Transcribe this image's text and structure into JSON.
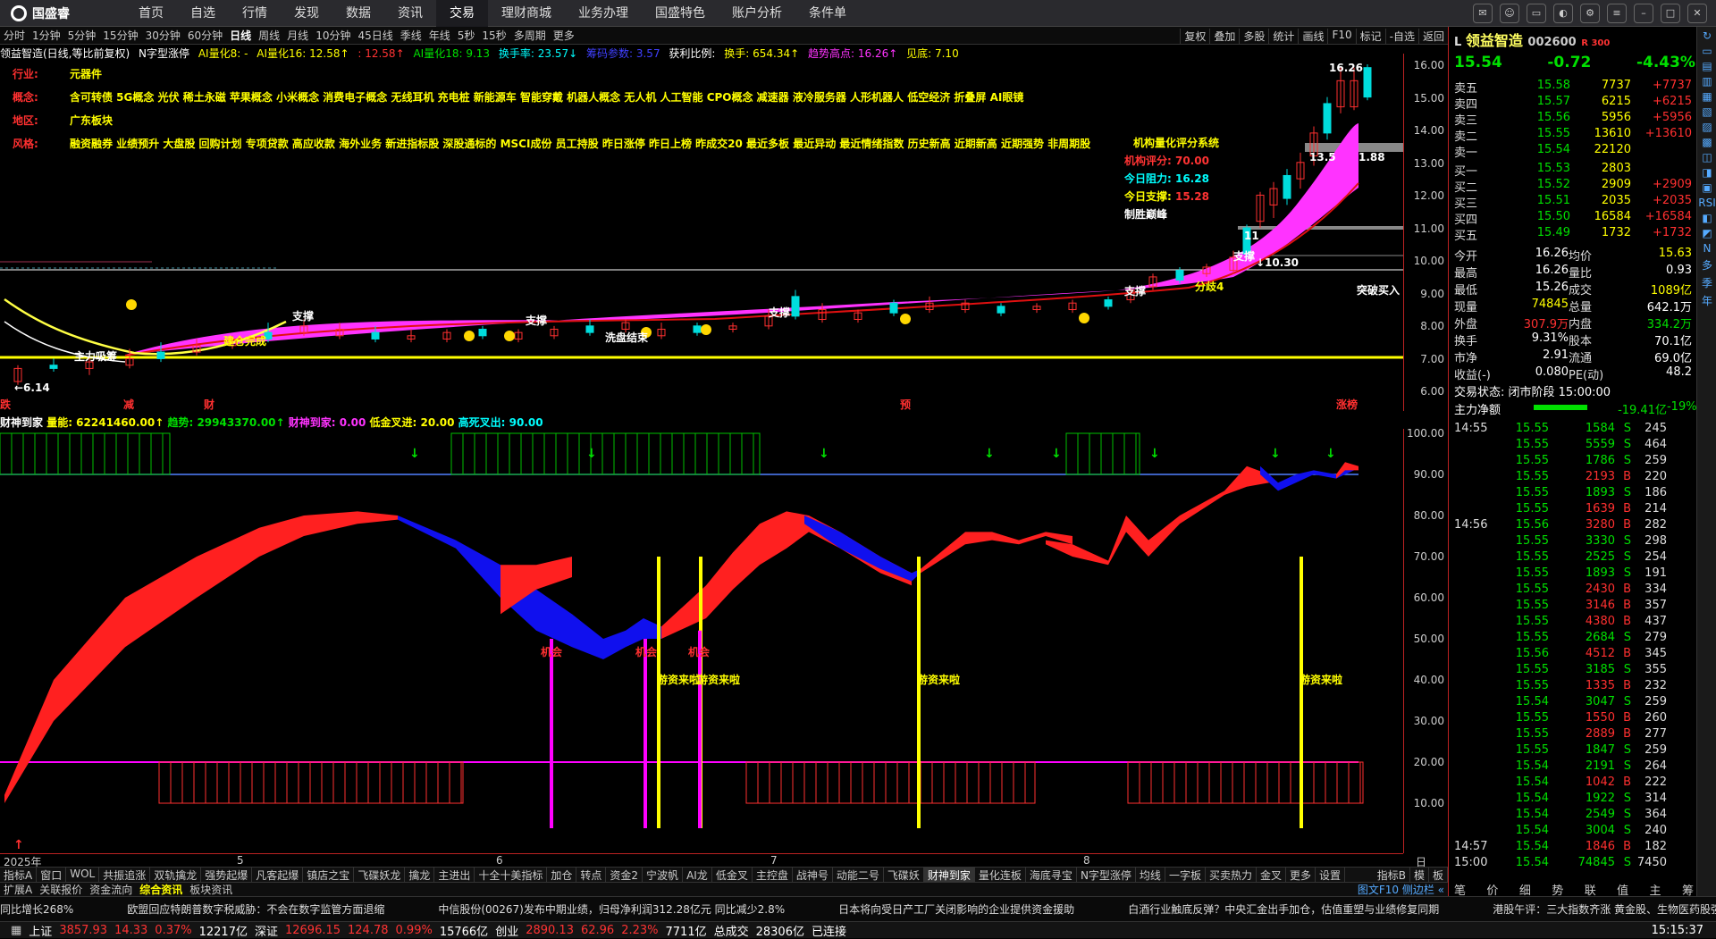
{
  "topbar": {
    "logo": "国盛睿",
    "menu": [
      "首页",
      "自选",
      "行情",
      "发现",
      "数据",
      "资讯",
      "交易",
      "理财商城",
      "业务办理",
      "国盛特色",
      "账户分析",
      "条件单"
    ],
    "selected": "交易"
  },
  "periods": [
    "分时",
    "1分钟",
    "5分钟",
    "15分钟",
    "30分钟",
    "60分钟",
    "日线",
    "周线",
    "月线",
    "10分钟",
    "45日线",
    "季线",
    "年线",
    "5秒",
    "15秒",
    "多周期",
    "更多"
  ],
  "period_selected": "日线",
  "tools": [
    "复权",
    "叠加",
    "多股",
    "统计",
    "画线",
    "F10",
    "标记",
    "-自选",
    "返回"
  ],
  "info": {
    "name": "领益智造(日线,等比前复权)",
    "ind1": "N字型涨停",
    "ind2": "AI量化8: -",
    "ind3": "AI量化16: 12.58↑",
    "ind4": ": 12.58↑",
    "ind5": "AI量化18: 9.13",
    "ind6": "换手率: 23.57↓",
    "ind7": "筹码参数: 3.57",
    "ind8": "获利比例:",
    "ind9": "换手: 654.34↑",
    "ind10": "趋势高点: 16.26↑",
    "ind11": "见底: 7.10"
  },
  "tags": [
    {
      "k": "行业:",
      "v": "元器件"
    },
    {
      "k": "概念:",
      "v": "含可转债 5G概念 光伏 稀土永磁 苹果概念 小米概念 消费电子概念 无线耳机 充电桩 新能源车 智能穿戴 机器人概念 无人机 人工智能 CPO概念 减速器 液冷服务器 人形机器人 低空经济 折叠屏 AI眼镜"
    },
    {
      "k": "地区:",
      "v": "广东板块"
    },
    {
      "k": "风格:",
      "v": "融资融券 业绩预升 大盘股 回购计划 专项贷款 高应收款 海外业务 新进指标股 深股通标的 MSCI成份 员工持股 昨日涨停 昨日上榜 昨成交20 最近多板 最近异动 最近情绪指数 历史新高 近期新高 近期强势 非周期股 "
    }
  ],
  "sysbox": {
    "title": "机构量化评分系统",
    "l1": "机构评分: ",
    "v1": "70.00",
    "l2": "今日阻力: ",
    "v2": "16.28",
    "l3": "今日支撑: ",
    "v3": "15.28",
    "l4": "制胜巅峰"
  },
  "main_labels": {
    "high": "16.26",
    "low": "←6.14",
    "l135": "13.5",
    "l188": "1.88",
    "l11": "11",
    "zc1": "支撑",
    "zc2": "支撑",
    "zc3": "支撑",
    "zc4": "支撑",
    "zc5": "支撑",
    "zc6": "支撑",
    "zlxc": "主力吸筹",
    "jcwc": "建仓完成",
    "xpjs": "洗盘结束",
    "fk4": "分歧4",
    "tpmr": "突破买入",
    "p1030": "↓10.30",
    "mk1": "跌",
    "mk2": "减",
    "mk3": "财",
    "mk4": "预",
    "mk5": "涨榜"
  },
  "yaxis1": [
    "16.00",
    "15.00",
    "14.00",
    "13.00",
    "12.00",
    "11.00",
    "10.00",
    "9.00",
    "8.00",
    "7.00",
    "6.00"
  ],
  "sub": {
    "title": "财神到家",
    "l1": "量能: 62241460.00↑",
    "l2": "趋势: 29943370.00↑",
    "l3": "财神到家: 0.00",
    "l4": "低金叉进: 20.00",
    "l5": "高死叉出: 90.00",
    "jh": "机会",
    "yzl": "游资来啦"
  },
  "yaxis2": [
    "100.00",
    "90.00",
    "80.00",
    "70.00",
    "60.00",
    "50.00",
    "40.00",
    "30.00",
    "20.00",
    "10.00"
  ],
  "dates": {
    "d0": "2025年",
    "d5": "5",
    "d6": "6",
    "d7": "7",
    "d8": "8",
    "period": "日线"
  },
  "tabs1": [
    "指标A",
    "窗口",
    "WOL",
    "共振追涨",
    "双轨擒龙",
    "强势起爆",
    "凡客起爆",
    "镇店之宝",
    "飞碟妖龙",
    "擒龙",
    "主进出",
    "十全十美指标",
    "加仓",
    "转点",
    "资金2",
    "宁波帆",
    "AI龙",
    "低金叉",
    "主控盘",
    "战神号",
    "动能二号",
    "飞碟妖",
    "财神到家",
    "量化连板",
    "海底寻宝",
    "N字型涨停",
    "均线",
    "一字板",
    "买卖热力",
    "金叉",
    "更多",
    "设置"
  ],
  "tabs1_sel": "财神到家",
  "tabs1_right": [
    "指标B",
    "模",
    "板"
  ],
  "tabs2": [
    "扩展A",
    "关联报价",
    "资金流向",
    "综合资讯",
    "板块资讯"
  ],
  "tabs2_sel": "综合资讯",
  "tabs2_right": "图文F10 侧边栏 «",
  "ticker": [
    "同比增长268%",
    "欧盟回应特朗普数字税威胁：不会在数字监管方面退缩",
    "中信股份(00267)发布中期业绩，归母净利润312.28亿元 同比减少2.8%",
    "日本将向受日产工厂关闭影响的企业提供资金援助",
    "白酒行业触底反弹？中央汇金出手加仓，估值重塑与业绩修复同期",
    "港股午评：三大指数齐涨 黄金股、生物医药股强势 丰导体股集"
  ],
  "status": {
    "sh": "上证",
    "shv": "3857.93",
    "shc": "14.33",
    "shp": "0.37%",
    "shm": "12217亿",
    "sz": "深证",
    "szv": "12696.15",
    "szc": "124.78",
    "szp": "0.99%",
    "szm": "15766亿",
    "cy": "创业",
    "cyv": "2890.13",
    "cyc": "62.96",
    "cyp": "2.23%",
    "cym": "7711亿",
    "zl": "总成交",
    "zlv": "28306亿",
    "conn": "已连接",
    "time": "15:15:37"
  },
  "quote": {
    "name": "领益智造",
    "code": "002600",
    "mark": "R 300",
    "price": "15.54",
    "chg": "-0.72",
    "pct": "-4.43%",
    "asks": [
      [
        "卖五",
        "15.58",
        "7737",
        "+7737"
      ],
      [
        "卖四",
        "15.57",
        "6215",
        "+6215"
      ],
      [
        "卖三",
        "15.56",
        "5956",
        "+5956"
      ],
      [
        "卖二",
        "15.55",
        "13610",
        "+13610"
      ],
      [
        "卖一",
        "15.54",
        "22120",
        ""
      ]
    ],
    "bids": [
      [
        "买一",
        "15.53",
        "2803",
        ""
      ],
      [
        "买二",
        "15.52",
        "2909",
        "+2909"
      ],
      [
        "买三",
        "15.51",
        "2035",
        "+2035"
      ],
      [
        "买四",
        "15.50",
        "16584",
        "+16584"
      ],
      [
        "买五",
        "15.49",
        "1732",
        "+1732"
      ]
    ],
    "stats": [
      [
        "今开",
        "16.26",
        "均价",
        "15.63"
      ],
      [
        "最高",
        "16.26",
        "量比",
        "0.93"
      ],
      [
        "最低",
        "15.26",
        "成交",
        "1089亿"
      ],
      [
        "现量",
        "74845",
        "总量",
        "642.1万"
      ],
      [
        "外盘",
        "307.9万",
        "内盘",
        "334.2万"
      ],
      [
        "换手",
        "9.31%",
        "股本",
        "70.1亿"
      ],
      [
        "市净",
        "2.91",
        "流通",
        "69.0亿"
      ],
      [
        "收益(-)",
        "0.080",
        "PE(动)",
        "48.2"
      ]
    ],
    "state": "交易状态: 闭市阶段 15:00:00",
    "net_label": "主力净额",
    "net_v": "-19.41亿",
    "net_p": "-19%",
    "ticks": [
      [
        "14:55",
        "15.55",
        "1584",
        "S",
        "245"
      ],
      [
        "",
        "15.55",
        "5559",
        "S",
        "464"
      ],
      [
        "",
        "15.55",
        "1786",
        "S",
        "259"
      ],
      [
        "",
        "15.55",
        "2193",
        "B",
        "220"
      ],
      [
        "",
        "15.55",
        "1893",
        "S",
        "186"
      ],
      [
        "",
        "15.55",
        "1639",
        "B",
        "214"
      ],
      [
        "14:56",
        "15.56",
        "3280",
        "B",
        "282"
      ],
      [
        "",
        "15.55",
        "3330",
        "S",
        "298"
      ],
      [
        "",
        "15.55",
        "2525",
        "S",
        "254"
      ],
      [
        "",
        "15.55",
        "1893",
        "S",
        "191"
      ],
      [
        "",
        "15.55",
        "2430",
        "B",
        "334"
      ],
      [
        "",
        "15.55",
        "3146",
        "B",
        "357"
      ],
      [
        "",
        "15.55",
        "4380",
        "B",
        "437"
      ],
      [
        "",
        "15.55",
        "2684",
        "S",
        "279"
      ],
      [
        "",
        "15.56",
        "4512",
        "B",
        "345"
      ],
      [
        "",
        "15.55",
        "3185",
        "S",
        "355"
      ],
      [
        "",
        "15.55",
        "1335",
        "B",
        "232"
      ],
      [
        "",
        "15.54",
        "3047",
        "S",
        "259"
      ],
      [
        "",
        "15.55",
        "1550",
        "B",
        "260"
      ],
      [
        "",
        "15.55",
        "2889",
        "B",
        "277"
      ],
      [
        "",
        "15.55",
        "1847",
        "S",
        "259"
      ],
      [
        "",
        "15.54",
        "2191",
        "S",
        "264"
      ],
      [
        "",
        "15.54",
        "1042",
        "B",
        "222"
      ],
      [
        "",
        "15.54",
        "1922",
        "S",
        "314"
      ],
      [
        "",
        "15.54",
        "2549",
        "S",
        "364"
      ],
      [
        "",
        "15.54",
        "3004",
        "S",
        "240"
      ],
      [
        "14:57",
        "15.54",
        "1846",
        "B",
        "182"
      ],
      [
        "15:00",
        "15.54",
        "74845",
        "S",
        "7450"
      ]
    ],
    "bottom_tabs": [
      "笔",
      "价",
      "细",
      "势",
      "联",
      "值",
      "主",
      "筹"
    ]
  },
  "side": [
    "↻",
    "▭",
    "▤",
    "▥",
    "▦",
    "▧",
    "▨",
    "▩",
    "◫",
    "◨",
    "▣",
    "RSI",
    "◧",
    "◩",
    "N",
    "多",
    "季",
    "年"
  ]
}
